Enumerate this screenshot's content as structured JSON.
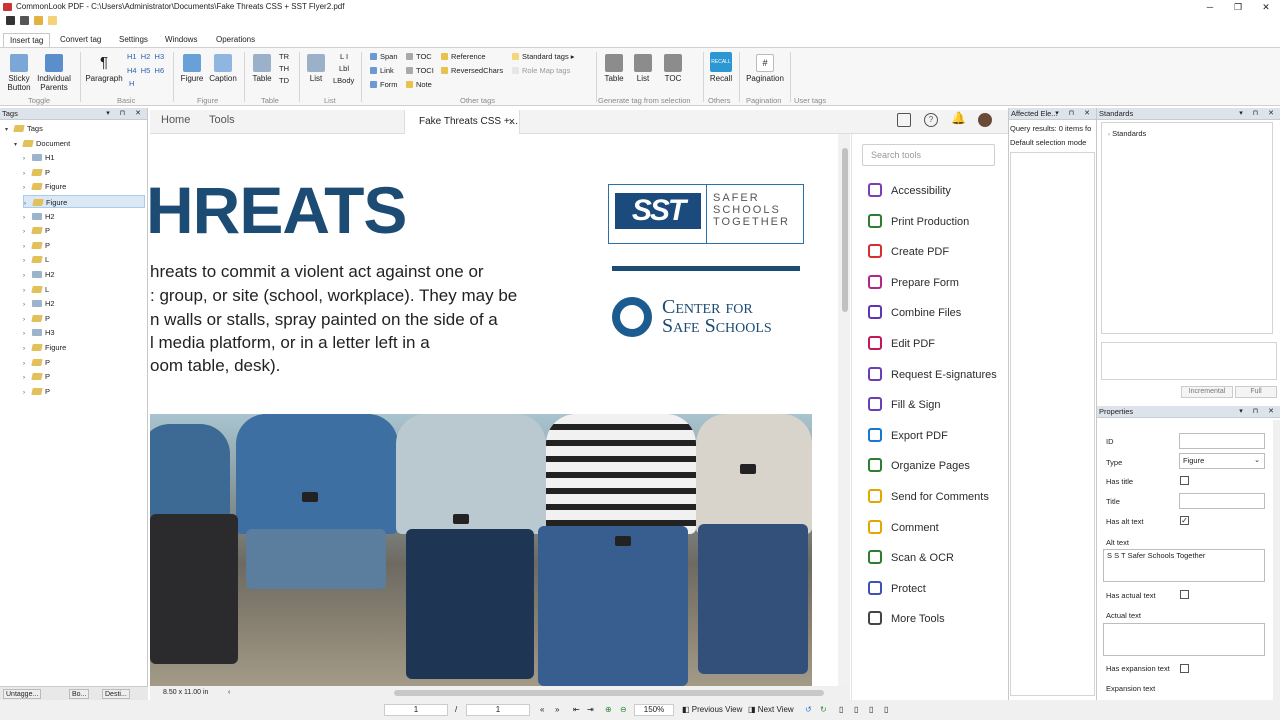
{
  "window": {
    "title": "CommonLook PDF - C:\\Users\\Administrator\\Documents\\Fake Threats CSS + SST Flyer2.pdf",
    "minimize": "─",
    "maximize": "❐",
    "close": "✕"
  },
  "ribbon_tabs": [
    "Insert tag",
    "Convert tag",
    "Settings",
    "Windows",
    "Operations"
  ],
  "ribbon": {
    "sticky": "Sticky\nButton",
    "sticky_1": "Sticky",
    "sticky_2": "Button",
    "indiv_1": "Individual",
    "indiv_2": "Parents",
    "paragraph": "Paragraph",
    "h_tags": [
      "H1",
      "H2",
      "H3",
      "H4",
      "H5",
      "H6",
      "H"
    ],
    "figure": "Figure",
    "caption": "Caption",
    "table": "Table",
    "tr": "TR",
    "th": "TH",
    "td": "TD",
    "list": "List",
    "li": "L I",
    "lbl": "Lbl",
    "lbody": "LBody",
    "span": "Span",
    "link": "Link",
    "form": "Form",
    "toc": "TOC",
    "toci": "TOCI",
    "note": "Note",
    "reference": "Reference",
    "reversedchars": "ReversedChars",
    "standard_tags": "Standard tags",
    "role_map_tags": "Role Map tags",
    "gen_table": "Table",
    "gen_list": "List",
    "gen_toc": "TOC",
    "recall": "Recall",
    "recall_badge": "RECALL",
    "pagination": "Pagination",
    "pagination_symbol": "#",
    "groups": {
      "toggle": "Toggle",
      "basic": "Basic",
      "figure": "Figure",
      "table": "Table",
      "list": "List",
      "other": "Other tags",
      "generate": "Generate tag from selection",
      "others": "Others",
      "pagination": "Pagination",
      "user": "User tags"
    }
  },
  "tags_panel": {
    "title": "Tags",
    "controls": "▾ ⊓ ✕",
    "items": [
      {
        "label": "Tags",
        "level": 0,
        "arrow": "▾",
        "heading": false
      },
      {
        "label": "Document",
        "level": 1,
        "arrow": "▾",
        "heading": false
      },
      {
        "label": "H1",
        "level": 2,
        "arrow": "›",
        "heading": true
      },
      {
        "label": "P",
        "level": 2,
        "arrow": "›",
        "heading": false
      },
      {
        "label": "Figure",
        "level": 2,
        "arrow": "›",
        "heading": false
      },
      {
        "label": "Figure",
        "level": 2,
        "arrow": "›",
        "heading": false,
        "selected": true
      },
      {
        "label": "H2",
        "level": 2,
        "arrow": "›",
        "heading": true
      },
      {
        "label": "P",
        "level": 2,
        "arrow": "›",
        "heading": false
      },
      {
        "label": "P",
        "level": 2,
        "arrow": "›",
        "heading": false
      },
      {
        "label": "L",
        "level": 2,
        "arrow": "›",
        "heading": false
      },
      {
        "label": "H2",
        "level": 2,
        "arrow": "›",
        "heading": true
      },
      {
        "label": "L",
        "level": 2,
        "arrow": "›",
        "heading": false
      },
      {
        "label": "H2",
        "level": 2,
        "arrow": "›",
        "heading": true
      },
      {
        "label": "P",
        "level": 2,
        "arrow": "›",
        "heading": false
      },
      {
        "label": "H3",
        "level": 2,
        "arrow": "›",
        "heading": true
      },
      {
        "label": "Figure",
        "level": 2,
        "arrow": "›",
        "heading": false
      },
      {
        "label": "P",
        "level": 2,
        "arrow": "›",
        "heading": false
      },
      {
        "label": "P",
        "level": 2,
        "arrow": "›",
        "heading": false
      },
      {
        "label": "P",
        "level": 2,
        "arrow": "›",
        "heading": false
      }
    ],
    "footer_tabs": [
      "Untagge...",
      "Bo...",
      "Desti..."
    ]
  },
  "acrobat": {
    "home": "Home",
    "tools": "Tools",
    "doc_tab": "Fake Threats CSS +...",
    "doc_tab_close": "×",
    "page_size": "8.50 x 11.00 in",
    "search_placeholder": "Search tools",
    "tools_list": [
      {
        "label": "Accessibility",
        "color": "#7a3fb5"
      },
      {
        "label": "Print Production",
        "color": "#2e7d32"
      },
      {
        "label": "Create PDF",
        "color": "#d32f2f"
      },
      {
        "label": "Prepare Form",
        "color": "#b0278c"
      },
      {
        "label": "Combine Files",
        "color": "#5e35b1"
      },
      {
        "label": "Edit PDF",
        "color": "#c2185b"
      },
      {
        "label": "Request E-signatures",
        "color": "#6a3fb5"
      },
      {
        "label": "Fill & Sign",
        "color": "#6a3fb5"
      },
      {
        "label": "Export PDF",
        "color": "#1976d2"
      },
      {
        "label": "Organize Pages",
        "color": "#2e7d32"
      },
      {
        "label": "Send for Comments",
        "color": "#e0a800"
      },
      {
        "label": "Comment",
        "color": "#e0a800"
      },
      {
        "label": "Scan & OCR",
        "color": "#2e7d32"
      },
      {
        "label": "Protect",
        "color": "#3f51b5"
      },
      {
        "label": "More Tools",
        "color": "#444444"
      }
    ]
  },
  "document": {
    "title": "HREATS",
    "lines": [
      "hreats to commit a violent act against one or",
      ": group, or site (school, workplace). They may be",
      "n walls or stalls, spray painted on the side of a",
      "l media platform, or in a letter left in a",
      "oom table, desk)."
    ],
    "sst_mark": "SST",
    "sst_lines": [
      "SAFER",
      "SCHOOLS",
      "TOGETHER"
    ],
    "cfs_lines": [
      "Center for",
      "Safe Schools"
    ]
  },
  "affected": {
    "title": "Affected Ele...",
    "query": "Query results: 0 items fo",
    "mode": "Default selection mode"
  },
  "standards": {
    "title": "Standards",
    "root": "Standards",
    "incremental": "Incremental",
    "full": "Full"
  },
  "properties": {
    "title": "Properties",
    "id_label": "ID",
    "id_value": "",
    "type_label": "Type",
    "type_value": "Figure",
    "has_title_label": "Has title",
    "has_title": false,
    "title_label": "Title",
    "title_value": "",
    "has_alt_label": "Has alt text",
    "has_alt": true,
    "alt_label": "Alt text",
    "alt_value": "S S T Safer Schools Together",
    "has_actual_label": "Has actual text",
    "actual_label": "Actual text",
    "actual_value": "",
    "has_expansion_label": "Has expansion text",
    "expansion_label": "Expansion text"
  },
  "statusbar": {
    "page_current": "1",
    "page_sep": "/",
    "page_total": "1",
    "zoom": "150%",
    "prev_view": "Previous View",
    "next_view": "Next View"
  }
}
